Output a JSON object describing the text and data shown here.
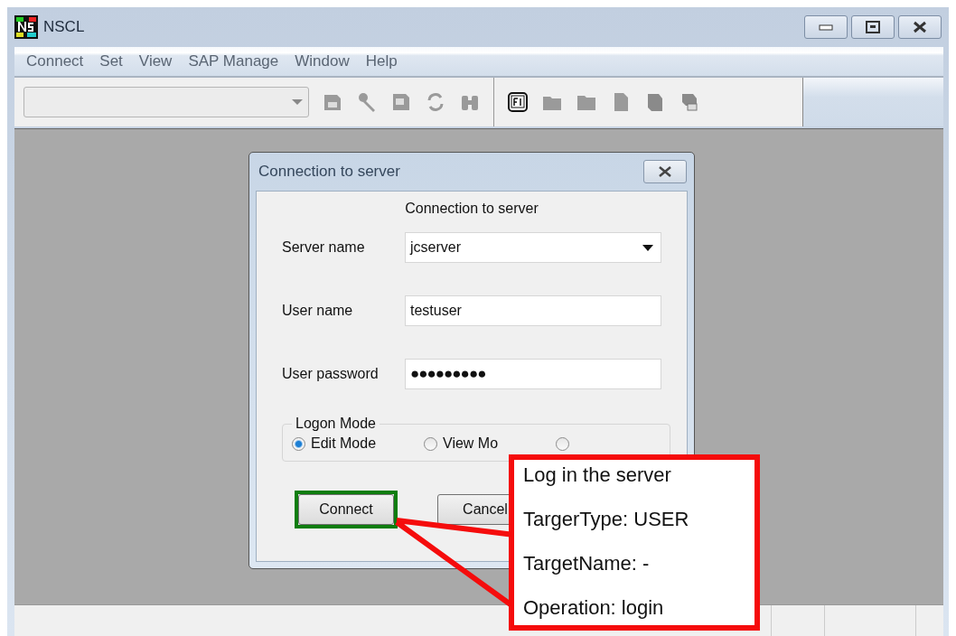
{
  "window": {
    "title": "NSCL"
  },
  "menu": [
    "Connect",
    "Set",
    "View",
    "SAP Manage",
    "Window",
    "Help"
  ],
  "dialog": {
    "title": "Connection to server",
    "heading": "Connection to server",
    "fields": [
      {
        "kind": "combo",
        "label": "Server name",
        "value": "jcserver"
      },
      {
        "kind": "text",
        "label": "User name",
        "value": "testuser"
      },
      {
        "kind": "password",
        "label": "User password",
        "value": "●●●●●●●●●"
      }
    ],
    "logon_mode": {
      "title": "Logon Mode",
      "options": [
        {
          "label": "Edit Mode",
          "selected": true
        },
        {
          "label": "View Mo",
          "selected": false
        },
        {
          "selected": false
        }
      ]
    },
    "buttons": [
      {
        "label": "Connect",
        "highlighted": true
      },
      {
        "label": "Cancel",
        "highlighted": false
      }
    ]
  },
  "callout": {
    "lines": [
      "Log in the server",
      "TargerType: USER",
      "TargetName: -",
      "Operation: login"
    ]
  }
}
